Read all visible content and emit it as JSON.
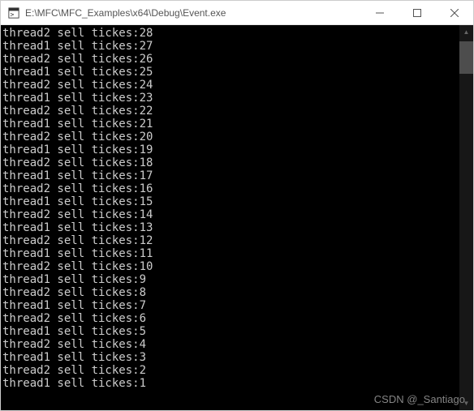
{
  "titlebar": {
    "title": "E:\\MFC\\MFC_Examples\\x64\\Debug\\Event.exe",
    "minimize_tip": "Minimize",
    "maximize_tip": "Maximize",
    "close_tip": "Close"
  },
  "console": {
    "lines": [
      "thread2 sell tickes:28",
      "thread1 sell tickes:27",
      "thread2 sell tickes:26",
      "thread1 sell tickes:25",
      "thread2 sell tickes:24",
      "thread1 sell tickes:23",
      "thread2 sell tickes:22",
      "thread1 sell tickes:21",
      "thread2 sell tickes:20",
      "thread1 sell tickes:19",
      "thread2 sell tickes:18",
      "thread1 sell tickes:17",
      "thread2 sell tickes:16",
      "thread1 sell tickes:15",
      "thread2 sell tickes:14",
      "thread1 sell tickes:13",
      "thread2 sell tickes:12",
      "thread1 sell tickes:11",
      "thread2 sell tickes:10",
      "thread1 sell tickes:9",
      "thread2 sell tickes:8",
      "thread1 sell tickes:7",
      "thread2 sell tickes:6",
      "thread1 sell tickes:5",
      "thread2 sell tickes:4",
      "thread1 sell tickes:3",
      "thread2 sell tickes:2",
      "thread1 sell tickes:1"
    ]
  },
  "watermark": "CSDN @_Santiago"
}
